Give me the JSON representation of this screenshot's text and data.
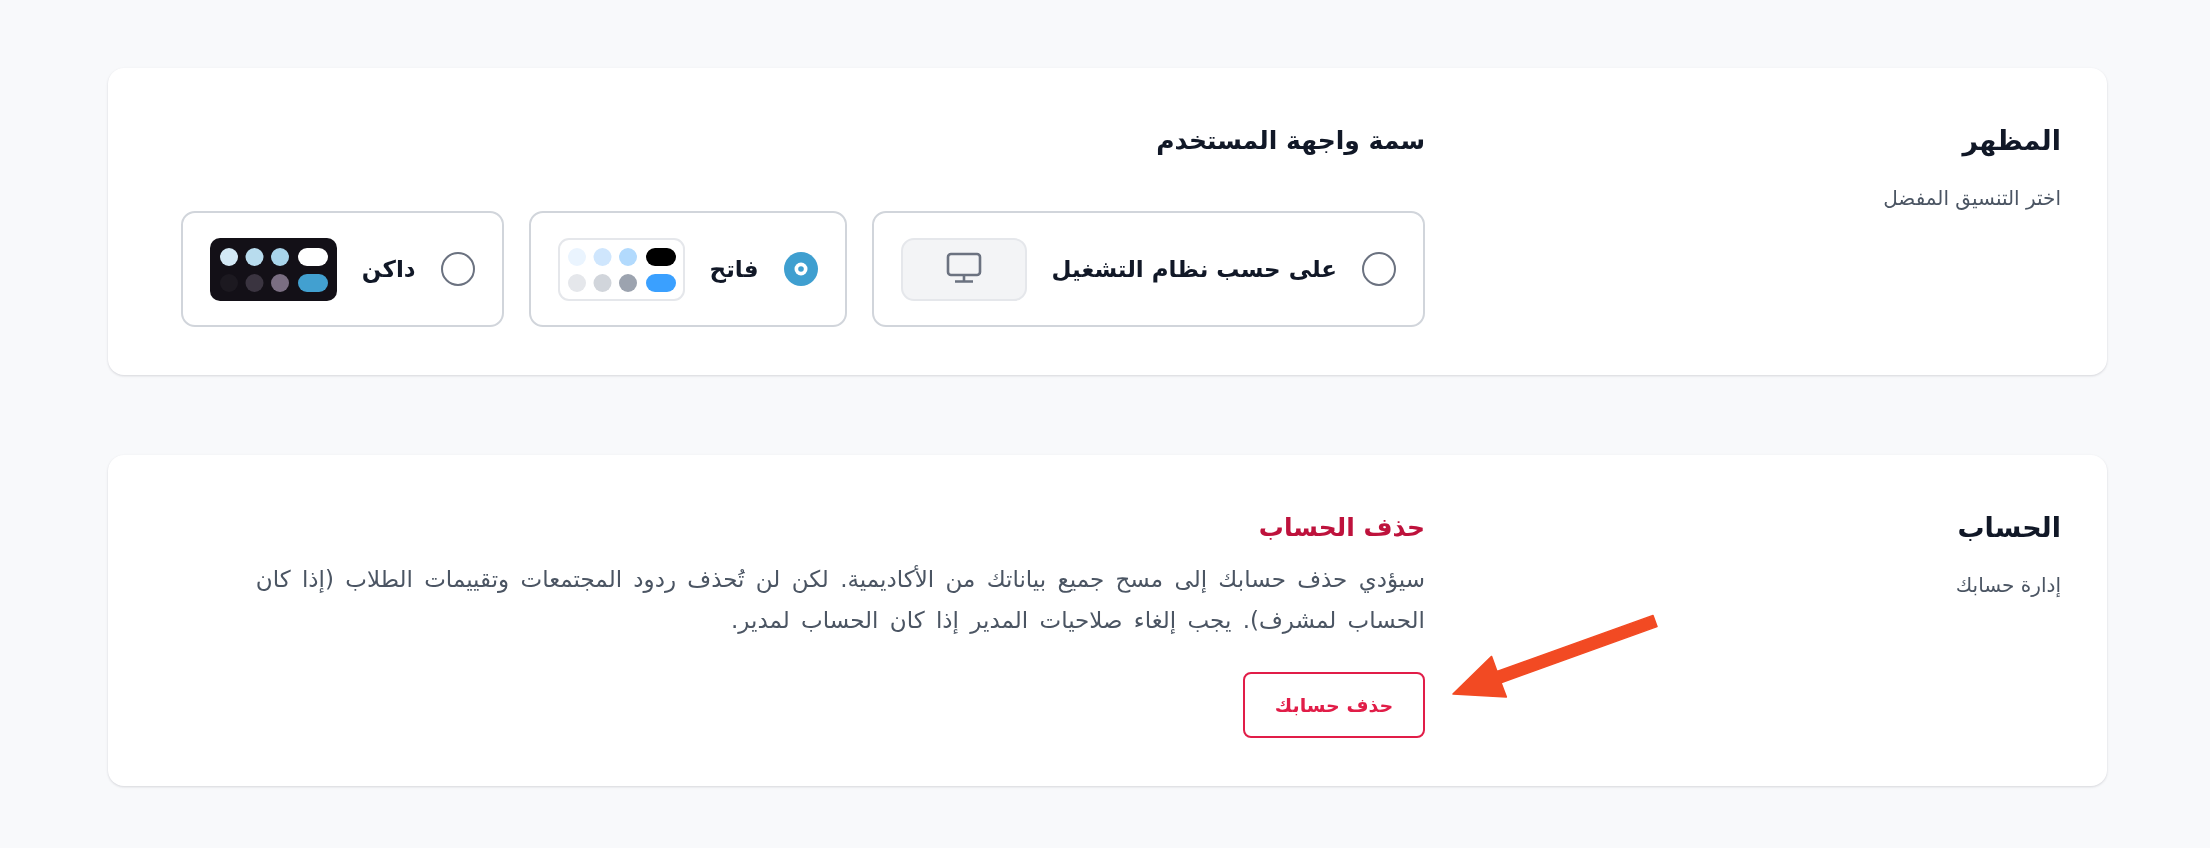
{
  "sections": [
    {
      "kind": "appearance",
      "title": "المظهر",
      "subtitle": "اختر التنسيق المفضل",
      "heading": "سمة واجهة المستخدم",
      "options": [
        {
          "kind": "system",
          "label": "على حسب نظام التشغيل",
          "selected": false
        },
        {
          "kind": "light",
          "label": "فاتح",
          "selected": true
        },
        {
          "kind": "dark",
          "label": "داكن",
          "selected": false
        }
      ]
    },
    {
      "kind": "danger",
      "title": "الحساب",
      "subtitle": "إدارة حسابك",
      "heading": "حذف الحساب",
      "description": "سيؤدي حذف حسابك إلى مسح جميع بياناتك من الأكاديمية. لكن لن تُحذف ردود المجتمعات وتقييمات الطلاب (إذا كان الحساب لمشرف). يجب إلغاء صلاحيات المدير إذا كان الحساب لمدير.",
      "button": "حذف حسابك",
      "annotation": {
        "kind": "arrow"
      }
    }
  ]
}
